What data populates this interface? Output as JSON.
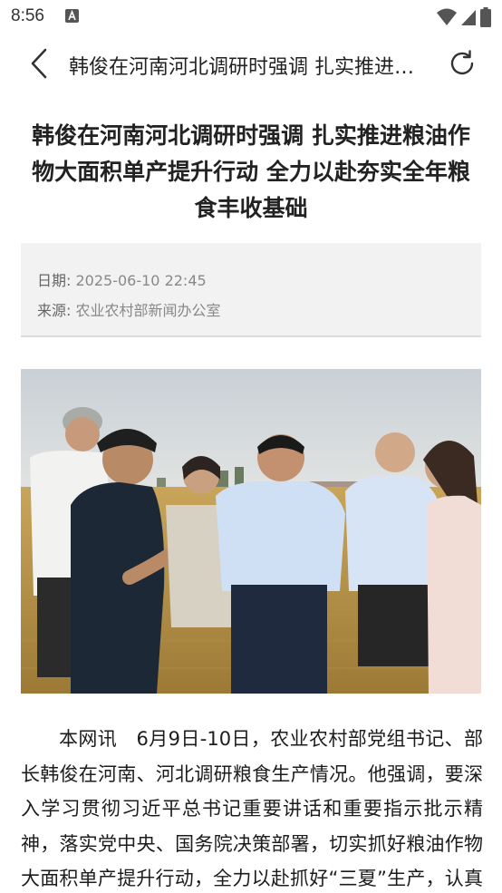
{
  "status_bar": {
    "time": "8:56",
    "icons": [
      "notification-a-icon",
      "wifi-icon",
      "cellular-icon",
      "battery-icon"
    ]
  },
  "nav": {
    "title": "韩俊在河南河北调研时强调 扎实推进粮油作物大面积单产提升行动 全力以赴夯实全年粮食丰收基础",
    "back_icon": "chevron-left-icon",
    "refresh_icon": "refresh-icon"
  },
  "article": {
    "title": "韩俊在河南河北调研时强调 扎实推进粮油作物大面积单产提升行动 全力以赴夯实全年粮食丰收基础",
    "date_label": "日期:",
    "date_value": "2025-06-10 22:45",
    "source_label": "来源:",
    "source_value": "农业农村部新闻办公室",
    "body": "本网讯　6月9日-10日，农业农村部党组书记、部长韩俊在河南、河北调研粮食生产情况。他强调，要深入学习贯彻习近平总书记重要讲话和重要指示批示精神，落实党中央、国务院决策部署，切实抓好粮油作物大面积单产提升行动，全力以赴抓好“三夏”生产，认真抓好夏收扫尾工"
  },
  "colors": {
    "background": "#ffffff",
    "meta_background": "#f2f2f2",
    "text": "#222222",
    "meta_text": "#888888"
  }
}
